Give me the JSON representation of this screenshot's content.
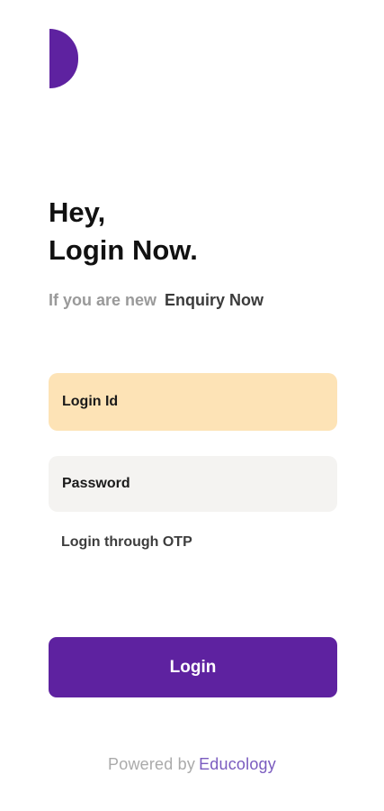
{
  "colors": {
    "brand_purple": "#5e22a0",
    "login_field_bg": "#fde3b6",
    "password_field_bg": "#f4f3f1",
    "muted_text": "#9a9a9a"
  },
  "logo": {
    "icon": "half-circle-logo-icon"
  },
  "header": {
    "line1": "Hey,",
    "line2": "Login Now."
  },
  "enquiry": {
    "prompt": "If you are new",
    "link_label": "Enquiry Now"
  },
  "form": {
    "login_id_placeholder": "Login Id",
    "password_placeholder": "Password",
    "otp_link_label": "Login through OTP",
    "submit_label": "Login"
  },
  "footer": {
    "prefix": "Powered by",
    "brand": "Educology"
  }
}
